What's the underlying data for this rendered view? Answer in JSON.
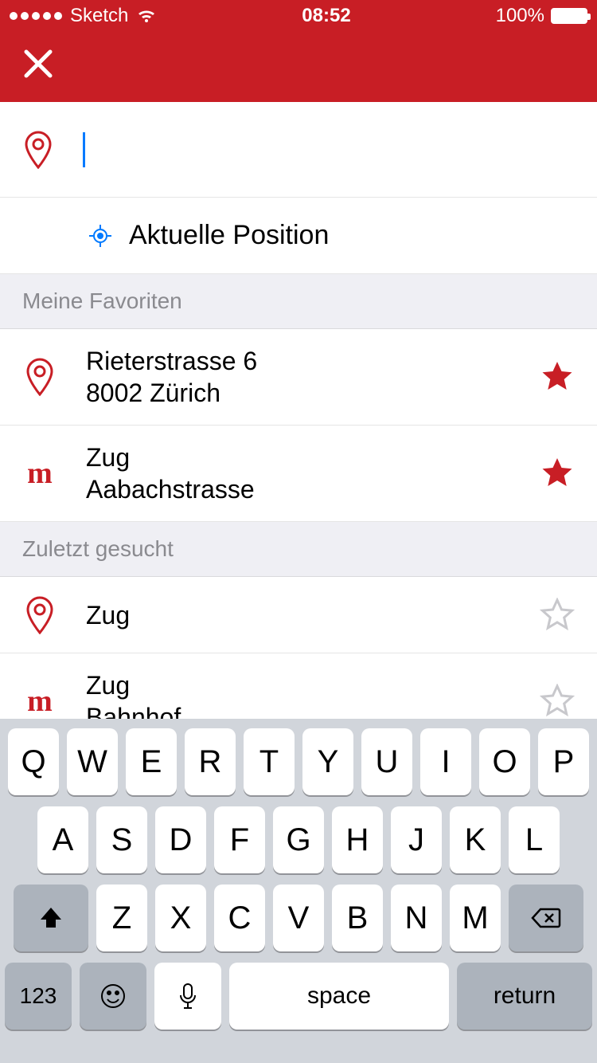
{
  "status": {
    "carrier": "Sketch",
    "time": "08:52",
    "battery": "100%"
  },
  "search": {
    "value": "",
    "placeholder": ""
  },
  "current_position": {
    "label": "Aktuelle Position"
  },
  "sections": {
    "favorites": {
      "header": "Meine Favoriten"
    },
    "recent": {
      "header": "Zuletzt gesucht"
    }
  },
  "favorites": [
    {
      "icon": "pin",
      "line1": "Rieterstrasse 6",
      "line2": "8002 Zürich",
      "favorited": true
    },
    {
      "icon": "m",
      "line1": "Zug",
      "line2": "Aabachstrasse",
      "favorited": true
    }
  ],
  "recent": [
    {
      "icon": "pin",
      "line1": "Zug",
      "line2": "",
      "favorited": false
    },
    {
      "icon": "m",
      "line1": "Zug",
      "line2": "Bahnhof",
      "favorited": false
    }
  ],
  "keyboard": {
    "row1": [
      "Q",
      "W",
      "E",
      "R",
      "T",
      "Y",
      "U",
      "I",
      "O",
      "P"
    ],
    "row2": [
      "A",
      "S",
      "D",
      "F",
      "G",
      "H",
      "J",
      "K",
      "L"
    ],
    "row3": [
      "Z",
      "X",
      "C",
      "V",
      "B",
      "N",
      "M"
    ],
    "numkey": "123",
    "space": "space",
    "return": "return"
  },
  "colors": {
    "brand": "#c81e25",
    "ios_blue": "#007aff",
    "grey": "#8a8a8f"
  }
}
